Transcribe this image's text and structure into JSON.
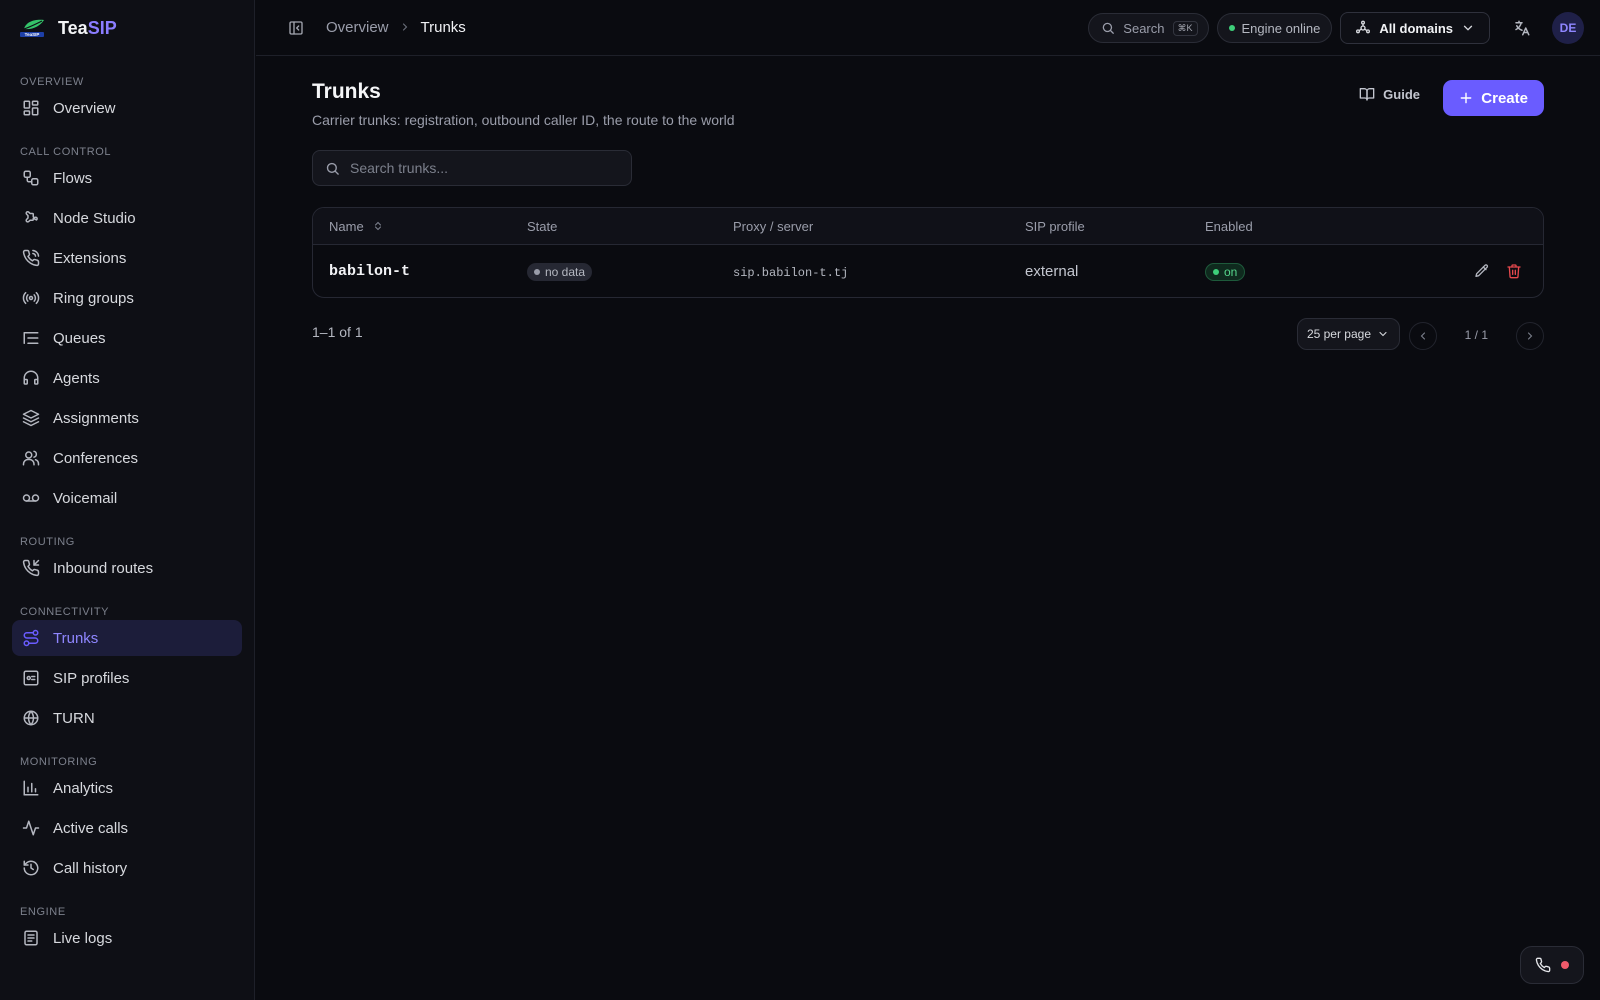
{
  "brand": {
    "name_part1": "Tea",
    "name_part2": "SIP"
  },
  "sidebar": {
    "sections": [
      {
        "title": "OVERVIEW",
        "items": [
          {
            "label": "Overview",
            "icon": "grid-icon"
          }
        ]
      },
      {
        "title": "CALL CONTROL",
        "items": [
          {
            "label": "Flows",
            "icon": "workflow-icon"
          },
          {
            "label": "Node Studio",
            "icon": "puzzle-icon"
          },
          {
            "label": "Extensions",
            "icon": "phone-call-icon"
          },
          {
            "label": "Ring groups",
            "icon": "radio-icon"
          },
          {
            "label": "Queues",
            "icon": "list-icon"
          },
          {
            "label": "Agents",
            "icon": "headset-icon"
          },
          {
            "label": "Assignments",
            "icon": "layers-icon"
          },
          {
            "label": "Conferences",
            "icon": "users-icon"
          },
          {
            "label": "Voicemail",
            "icon": "voicemail-icon"
          }
        ]
      },
      {
        "title": "ROUTING",
        "items": [
          {
            "label": "Inbound routes",
            "icon": "phone-incoming-icon"
          }
        ]
      },
      {
        "title": "CONNECTIVITY",
        "items": [
          {
            "label": "Trunks",
            "icon": "route-icon",
            "active": true
          },
          {
            "label": "SIP profiles",
            "icon": "server-icon"
          },
          {
            "label": "TURN",
            "icon": "globe-icon"
          }
        ]
      },
      {
        "title": "MONITORING",
        "items": [
          {
            "label": "Analytics",
            "icon": "bar-chart-icon"
          },
          {
            "label": "Active calls",
            "icon": "activity-icon"
          },
          {
            "label": "Call history",
            "icon": "history-icon"
          }
        ]
      },
      {
        "title": "ENGINE",
        "items": [
          {
            "label": "Live logs",
            "icon": "scroll-icon"
          }
        ]
      }
    ]
  },
  "topbar": {
    "breadcrumb": {
      "root": "Overview",
      "current": "Trunks"
    },
    "search_label": "Search",
    "search_shortcut": "⌘K",
    "engine_status": "Engine online",
    "domains_label": "All domains",
    "avatar_initials": "DE"
  },
  "page": {
    "title": "Trunks",
    "subtitle": "Carrier trunks: registration, outbound caller ID, the route to the world",
    "guide_label": "Guide",
    "create_label": "Create",
    "search_placeholder": "Search trunks..."
  },
  "table": {
    "columns": {
      "name": "Name",
      "state": "State",
      "proxy": "Proxy / server",
      "profile": "SIP profile",
      "enabled": "Enabled"
    },
    "rows": [
      {
        "name": "babilon-t",
        "state": "no data",
        "proxy": "sip.babilon-t.tj",
        "profile": "external",
        "enabled": "on"
      }
    ]
  },
  "pagination": {
    "range": "1–1 of 1",
    "per_page": "25 per page",
    "page": "1 / 1"
  },
  "colors": {
    "accent": "#6a5cff",
    "online": "#3ecf7a",
    "danger": "#e5484d",
    "phone_status": "#f05a6b"
  }
}
